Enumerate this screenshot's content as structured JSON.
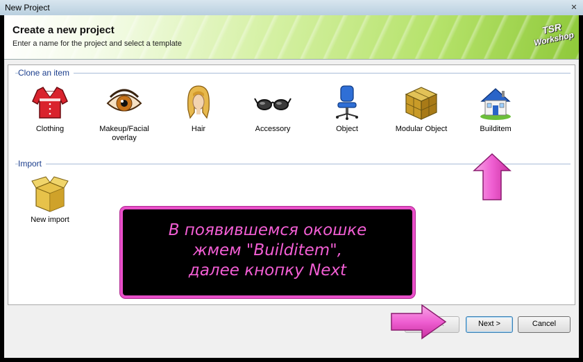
{
  "window": {
    "title": "New Project"
  },
  "header": {
    "title": "Create a new project",
    "subtitle": "Enter a name for the project and select a template",
    "logo_lines": [
      "TSR",
      "Workshop"
    ]
  },
  "sections": {
    "clone": {
      "label": "Clone an item",
      "items": [
        {
          "label": "Clothing",
          "icon": "shirt-icon"
        },
        {
          "label": "Makeup/Facial overlay",
          "icon": "eye-icon"
        },
        {
          "label": "Hair",
          "icon": "hair-icon"
        },
        {
          "label": "Accessory",
          "icon": "glasses-icon"
        },
        {
          "label": "Object",
          "icon": "chair-icon"
        },
        {
          "label": "Modular Object",
          "icon": "cube-icon"
        },
        {
          "label": "Builditem",
          "icon": "house-icon"
        }
      ]
    },
    "import": {
      "label": "Import",
      "items": [
        {
          "label": "New import",
          "icon": "box-icon"
        }
      ]
    }
  },
  "buttons": {
    "back": "< Back",
    "next": "Next >",
    "cancel": "Cancel"
  },
  "annotation": {
    "text": "В появившемся окошке\nжмем \"Builditem\",\nдалее кнопку Next",
    "accent": "#f25ed4"
  }
}
